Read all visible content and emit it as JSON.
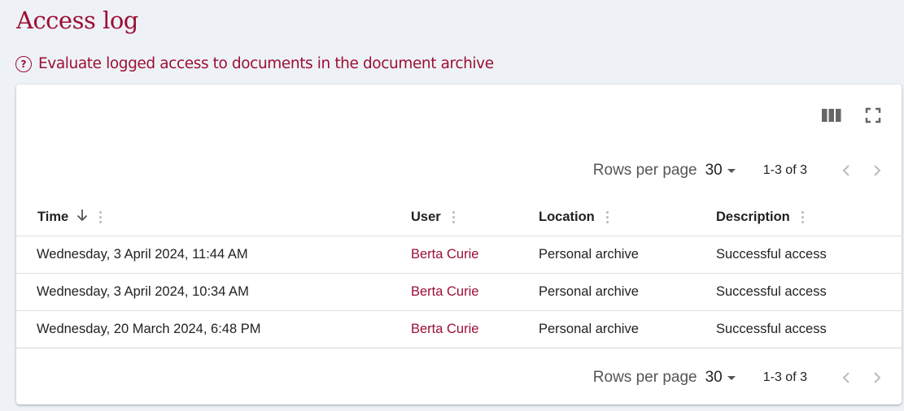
{
  "page": {
    "title": "Access log",
    "subtitle": "Evaluate logged access to documents in the document archive",
    "help_icon": "help-circle-icon"
  },
  "toolbar": {
    "columns_icon": "view-columns-icon",
    "fullscreen_icon": "fullscreen-icon"
  },
  "pagination": {
    "rows_per_page_label": "Rows per page",
    "rows_per_page_value": "30",
    "range": "1-3 of 3"
  },
  "table": {
    "columns": [
      {
        "label": "Time",
        "sorted": "desc"
      },
      {
        "label": "User"
      },
      {
        "label": "Location"
      },
      {
        "label": "Description"
      }
    ],
    "rows": [
      {
        "time": "Wednesday, 3 April 2024, 11:44 AM",
        "user": "Berta Curie",
        "location": "Personal archive",
        "description": "Successful access"
      },
      {
        "time": "Wednesday, 3 April 2024, 10:34 AM",
        "user": "Berta Curie",
        "location": "Personal archive",
        "description": "Successful access"
      },
      {
        "time": "Wednesday, 20 March 2024, 6:48 PM",
        "user": "Berta Curie",
        "location": "Personal archive",
        "description": "Successful access"
      }
    ]
  },
  "colors": {
    "accent": "#9c0f35",
    "background": "#eef2f6"
  }
}
